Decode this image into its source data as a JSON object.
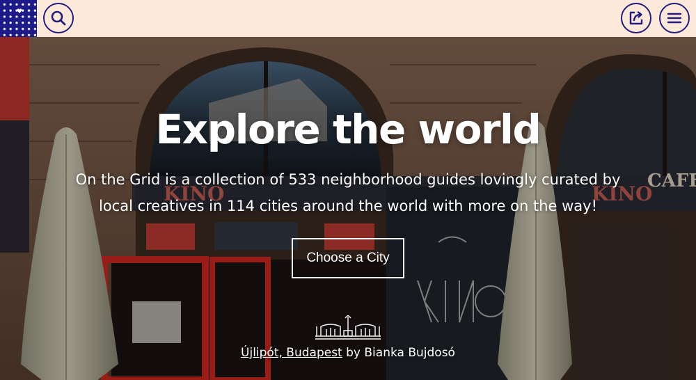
{
  "header": {
    "logo_icon": "heart-icon",
    "search_icon": "search-icon",
    "share_icon": "share-icon",
    "menu_icon": "menu-icon",
    "colors": {
      "bar_bg": "#fde9da",
      "accent": "#231c7e",
      "logo_bg": "#1f1a8a"
    }
  },
  "hero": {
    "title": "Explore the world",
    "subtitle_line1": "On the Grid is a collection of 533 neighborhood guides lovingly curated by",
    "subtitle_line2": "local creatives in 114 cities around the world with more on the way!",
    "cta_label": "Choose a City",
    "credit": {
      "neighborhood_link": "Újlipót, Budapest",
      "by_text": " by Bianka Bujdosó"
    },
    "landmark_icon": "landmark-icon"
  }
}
